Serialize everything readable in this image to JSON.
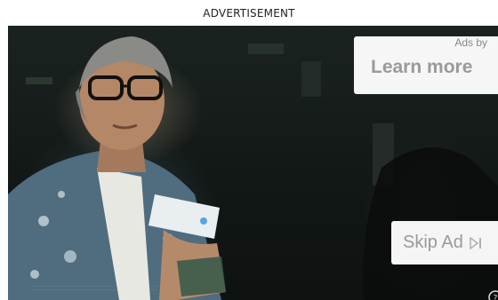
{
  "ad": {
    "header_label": "ADVERTISEMENT",
    "ads_by": "Ads by",
    "learn_more": "Learn more",
    "skip_ad": "Skip Ad"
  },
  "icons": {
    "skip": "skip-next-icon",
    "info": "info-icon"
  },
  "colors": {
    "overlay_bg": "#ffffff",
    "overlay_text": "#9a9a9a",
    "video_bg": "#121816"
  }
}
